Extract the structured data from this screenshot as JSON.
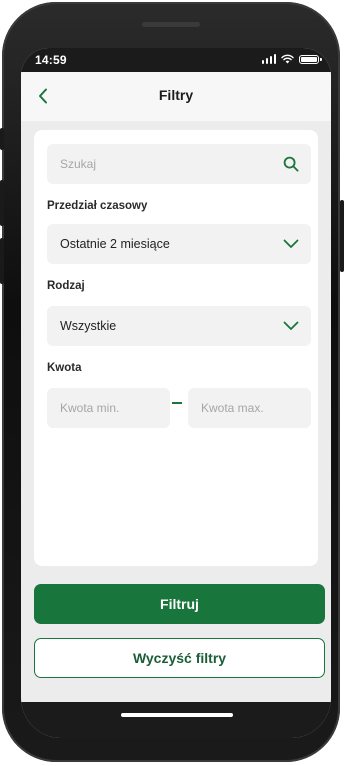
{
  "status_bar": {
    "time": "14:59",
    "icons": [
      "cellular-signal-icon",
      "wifi-icon",
      "battery-icon"
    ]
  },
  "header": {
    "title": "Filtry",
    "back_icon": "chevron-left-icon"
  },
  "filters": {
    "search": {
      "placeholder": "Szukaj",
      "icon": "search-icon"
    },
    "time_range": {
      "label": "Przedział czasowy",
      "value": "Ostatnie 2 miesiące",
      "icon": "chevron-down-icon"
    },
    "type": {
      "label": "Rodzaj",
      "value": "Wszystkie",
      "icon": "chevron-down-icon"
    },
    "amount": {
      "label": "Kwota",
      "min_placeholder": "Kwota min.",
      "max_placeholder": "Kwota max."
    }
  },
  "actions": {
    "apply_label": "Filtruj",
    "clear_label": "Wyczyść filtry"
  },
  "colors": {
    "brand_green": "#18753b",
    "background": "#ececec",
    "field_background": "#f2f2f2"
  }
}
